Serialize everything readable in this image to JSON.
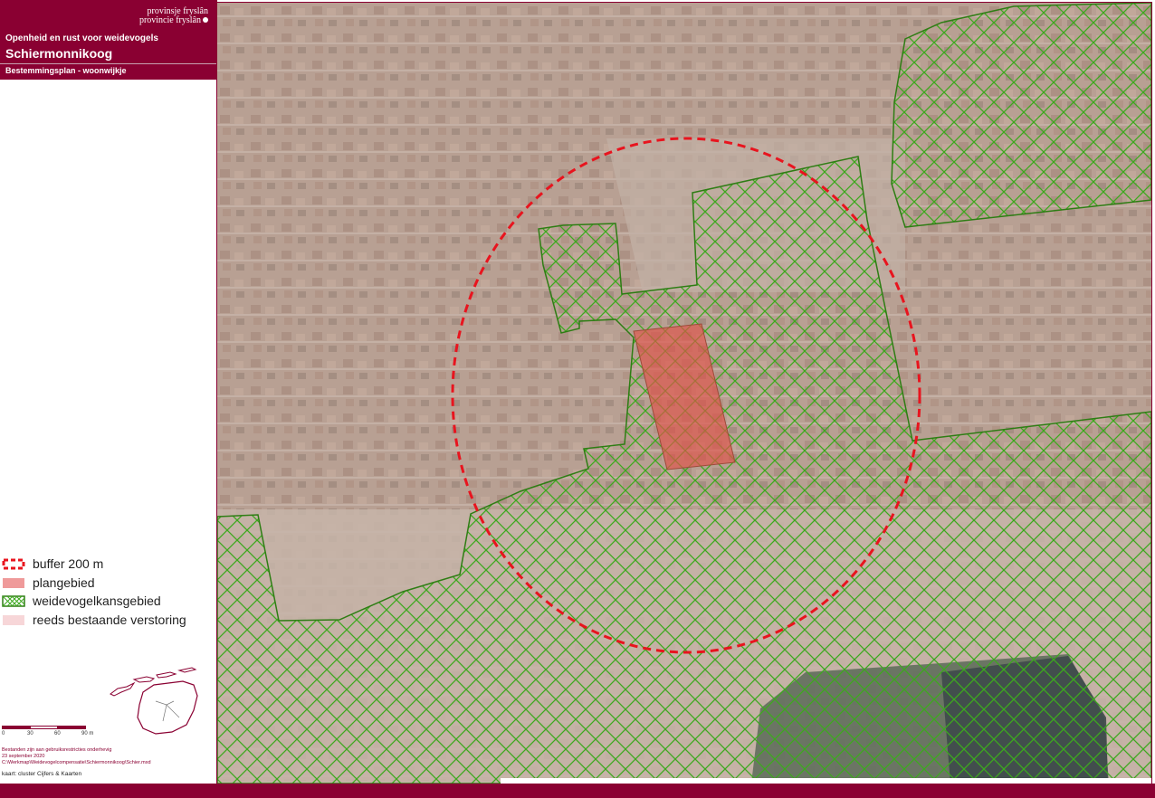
{
  "header": {
    "logo_line1": "provinsje fryslân",
    "logo_line2": "provincie fryslân",
    "subtitle": "Openheid en rust voor weidevogels",
    "title": "Schiermonnikoog",
    "plan_label": "Bestemmingsplan - woonwijkje"
  },
  "legend": {
    "items": [
      {
        "label": "buffer 200 m",
        "icon": "dashed-red-outline-icon"
      },
      {
        "label": "plangebied",
        "icon": "red-fill-icon"
      },
      {
        "label": "weidevogelkansgebied",
        "icon": "green-crosshatch-icon"
      },
      {
        "label": "reeds bestaande verstoring",
        "icon": "pink-fill-icon"
      }
    ]
  },
  "scale": {
    "labels": [
      "0",
      "30",
      "60",
      "90 m"
    ]
  },
  "notes": {
    "line1": "Bestanden zijn aan gebruiksrestricties onderhevig",
    "line2": "23 september 2020",
    "line3": "C:\\Werkmap\\Weidevogelcompensatie\\Schiermonnikoog\\Schier.mxd",
    "credit": "kaart: cluster Cijfers & Kaarten"
  },
  "colors": {
    "brand": "#8a0032",
    "buffer": "#e8141e",
    "plangebied": "#d9534a",
    "hatch": "#3da81e",
    "verstoring": "#f7d6d8"
  }
}
